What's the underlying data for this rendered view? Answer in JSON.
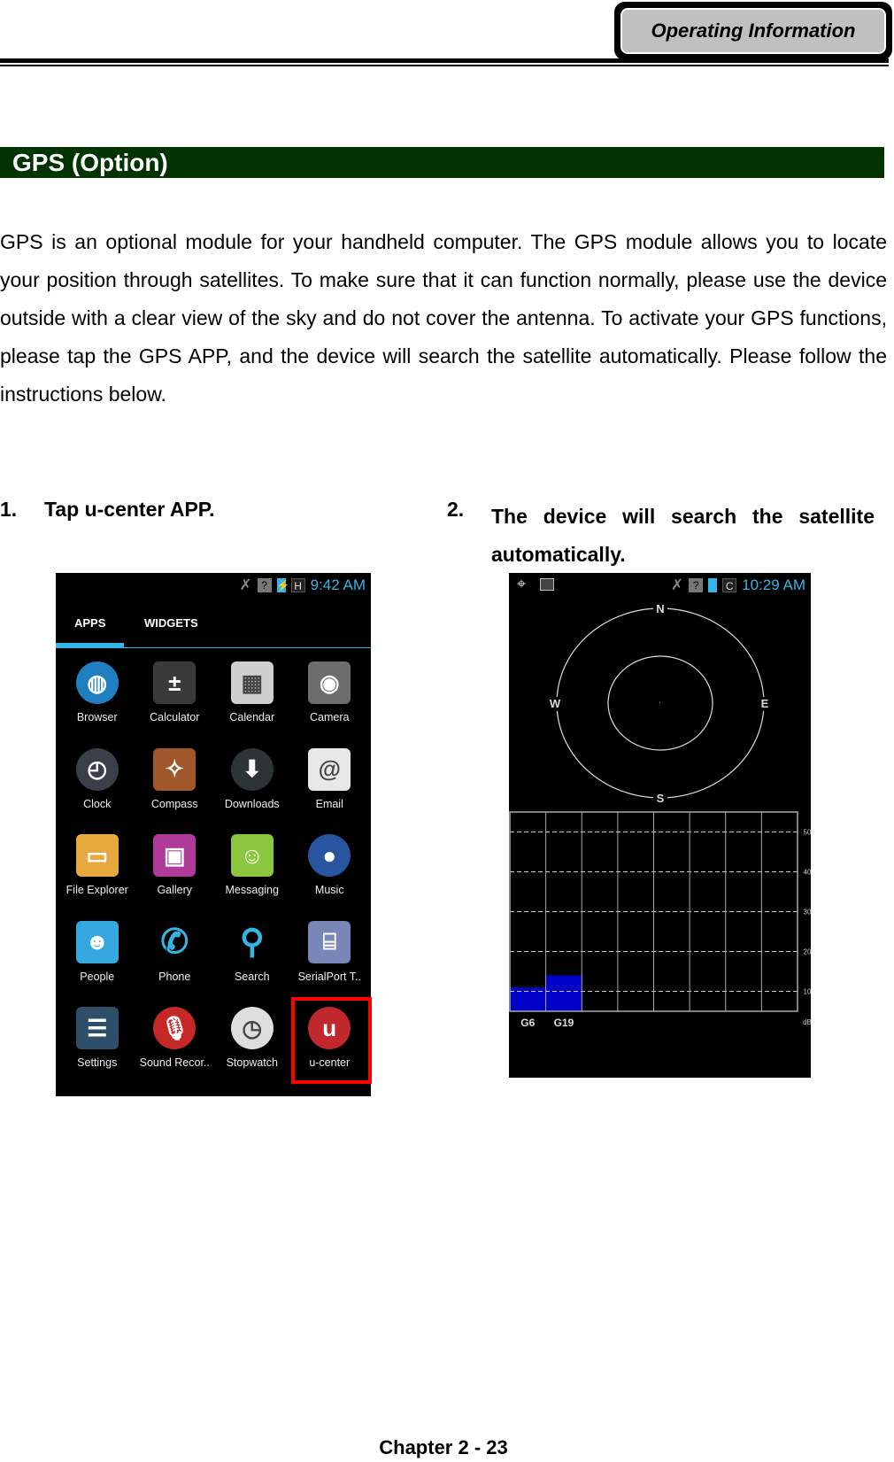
{
  "header": {
    "tab_label": "Operating Information"
  },
  "section": {
    "title": "GPS (Option)"
  },
  "body": {
    "paragraph": "GPS is an optional module for your handheld computer. The GPS module allows you to locate your position through satellites. To make sure that it can function normally, please use the device outside with a clear view of the sky and do not cover the antenna. To activate your GPS functions, please tap the GPS APP, and the device will search the satellite automatically. Please follow the instructions below."
  },
  "steps": [
    {
      "num": "1.",
      "text": "Tap u-center APP."
    },
    {
      "num": "2.",
      "text": "The device will search the satellite automatically."
    }
  ],
  "phone1": {
    "time": "9:42 AM",
    "status_icons": [
      "mute-icon",
      "no-sim-signal-icon",
      "battery-charging-icon",
      "h-network-icon"
    ],
    "tabs": [
      "APPS",
      "WIDGETS"
    ],
    "active_tab": "APPS",
    "accent": "#33b5e5",
    "apps": [
      {
        "label": "Browser",
        "icon": "globe-icon",
        "color": "#1f7fc0",
        "glyph": "◍"
      },
      {
        "label": "Calculator",
        "icon": "calculator-icon",
        "color": "#3a3a3a",
        "glyph": "±"
      },
      {
        "label": "Calendar",
        "icon": "calendar-icon",
        "color": "#cfcfcf",
        "glyph": "▦"
      },
      {
        "label": "Camera",
        "icon": "camera-icon",
        "color": "#6d6d6d",
        "glyph": "◉"
      },
      {
        "label": "Clock",
        "icon": "clock-icon",
        "color": "#3b3f4a",
        "glyph": "◴"
      },
      {
        "label": "Compass",
        "icon": "compass-icon",
        "color": "#a0582a",
        "glyph": "✧"
      },
      {
        "label": "Downloads",
        "icon": "download-icon",
        "color": "#2e3436",
        "glyph": "⬇"
      },
      {
        "label": "Email",
        "icon": "email-icon",
        "color": "#e8e8e8",
        "glyph": "@"
      },
      {
        "label": "File Explorer",
        "icon": "folder-icon",
        "color": "#e7a83d",
        "glyph": "▭"
      },
      {
        "label": "Gallery",
        "icon": "gallery-icon",
        "color": "#b03a9a",
        "glyph": "▣"
      },
      {
        "label": "Messaging",
        "icon": "messaging-icon",
        "color": "#8cc63f",
        "glyph": "☺"
      },
      {
        "label": "Music",
        "icon": "music-speaker-icon",
        "color": "#2855a0",
        "glyph": "●"
      },
      {
        "label": "People",
        "icon": "people-icon",
        "color": "#36a8e0",
        "glyph": "☻"
      },
      {
        "label": "Phone",
        "icon": "phone-icon",
        "color": "#000000",
        "glyph": "✆"
      },
      {
        "label": "Search",
        "icon": "search-icon",
        "color": "#000000",
        "glyph": "⚲"
      },
      {
        "label": "SerialPort T..",
        "icon": "serial-port-icon",
        "color": "#7a86b8",
        "glyph": "⌸"
      },
      {
        "label": "Settings",
        "icon": "settings-icon",
        "color": "#2f4e6a",
        "glyph": "☰"
      },
      {
        "label": "Sound Recor..",
        "icon": "microphone-icon",
        "color": "#c62828",
        "glyph": "🎙"
      },
      {
        "label": "Stopwatch",
        "icon": "stopwatch-icon",
        "color": "#dddddd",
        "glyph": "◷"
      },
      {
        "label": "u-center",
        "icon": "u-center-icon",
        "color": "#c0282d",
        "glyph": "u",
        "highlighted": true
      }
    ]
  },
  "phone2": {
    "time": "10:29 AM",
    "status_icons": [
      "gps-icon",
      "image-icon",
      "mute-icon",
      "no-sim-signal-icon",
      "battery-icon",
      "c-icon"
    ],
    "compass": [
      "N",
      "E",
      "S",
      "W"
    ],
    "chart_data": {
      "type": "bar",
      "categories": [
        "G6",
        "G19"
      ],
      "values": [
        11,
        14
      ],
      "ylabel": "dB",
      "yticks": [
        10,
        20,
        30,
        40,
        50
      ],
      "ylim": [
        5,
        55
      ],
      "columns": 8,
      "bar_color": "#0000c8",
      "grid": true
    }
  },
  "footer": {
    "page": "Chapter 2 - 23"
  }
}
